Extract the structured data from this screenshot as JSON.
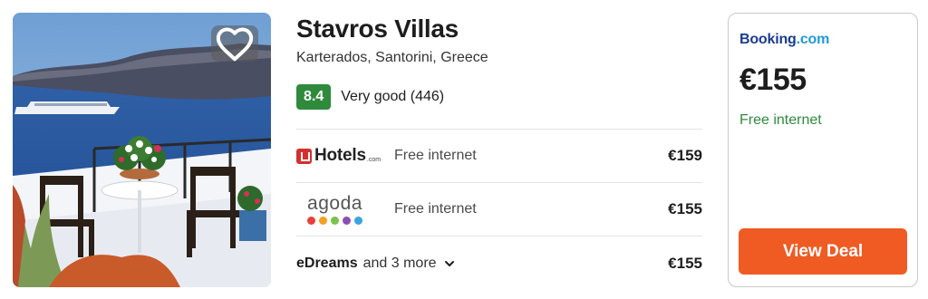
{
  "hotel": {
    "name": "Stavros Villas",
    "location": "Karterados, Santorini, Greece",
    "score": "8.4",
    "rating_label": "Very good (446)"
  },
  "photo": {
    "alt_icon": "favorite-heart-icon"
  },
  "providers": [
    {
      "name": "Hotels.com",
      "logo_text": "Hotels",
      "logo_suffix": ".com",
      "feature": "Free internet",
      "price": "€159"
    },
    {
      "name": "agoda",
      "logo_text": "agoda",
      "feature": "Free internet",
      "price": "€155"
    },
    {
      "name": "eDreams",
      "logo_text": "eDreams",
      "more": "and 3 more",
      "price": "€155"
    }
  ],
  "deal": {
    "provider_prefix": "Booking",
    "provider_suffix": ".com",
    "price": "€155",
    "feature": "Free internet",
    "button_label": "View Deal"
  },
  "colors": {
    "score_bg": "#2f8a3c",
    "cta": "#ef5b23",
    "booking_blue": "#1a3c8f",
    "feature_green": "#2f8a3c",
    "agoda_dots": [
      "#e5403a",
      "#f4a023",
      "#7bc24a",
      "#8d4fb2",
      "#3aa3e0"
    ]
  }
}
